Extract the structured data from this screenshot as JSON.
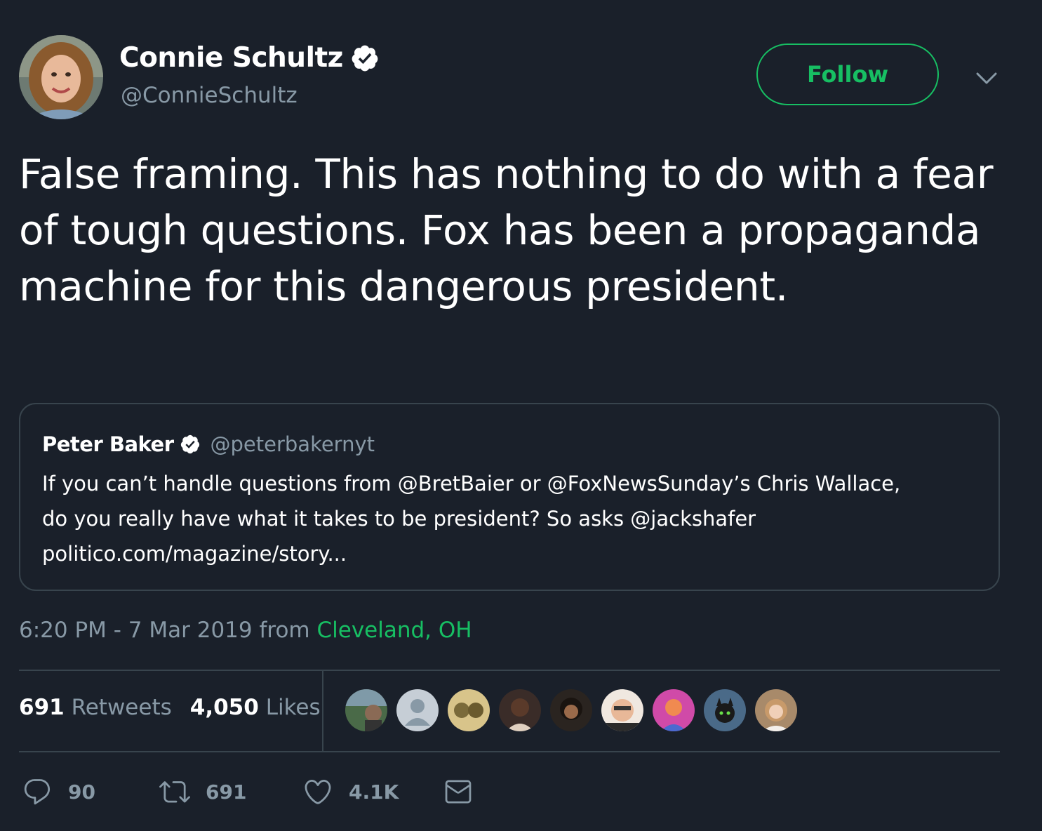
{
  "author": {
    "name": "Connie Schultz",
    "handle": "@ConnieSchultz",
    "verified": true
  },
  "follow_label": "Follow",
  "tweet_text": "False framing. This has nothing to do with a fear of tough questions. Fox has been a propaganda machine for this dangerous president.",
  "quoted": {
    "name": "Peter Baker",
    "handle": "@peterbakernyt",
    "verified": true,
    "text_line1": "If you can’t handle questions from @BretBaier or @FoxNewsSunday’s Chris Wallace,",
    "text_line2": "do you really have what it takes to be president? So asks @jackshafer",
    "link": "politico.com/magazine/story..."
  },
  "meta": {
    "time": "6:20 PM - 7 Mar 2019",
    "from_word": "from",
    "location": "Cleveland, OH"
  },
  "stats": {
    "retweets_count": "691",
    "retweets_label": "Retweets",
    "likes_count": "4,050",
    "likes_label": "Likes"
  },
  "likers_count_shown": 9,
  "actions": {
    "replies": "90",
    "retweets": "691",
    "likes": "4.1K"
  },
  "colors": {
    "background": "#1a202a",
    "accent_green": "#17bf63",
    "muted": "#8899a6",
    "border": "#38444d"
  },
  "icons": [
    "verified-badge-icon",
    "chevron-down-icon",
    "reply-icon",
    "retweet-icon",
    "like-icon",
    "message-icon"
  ]
}
